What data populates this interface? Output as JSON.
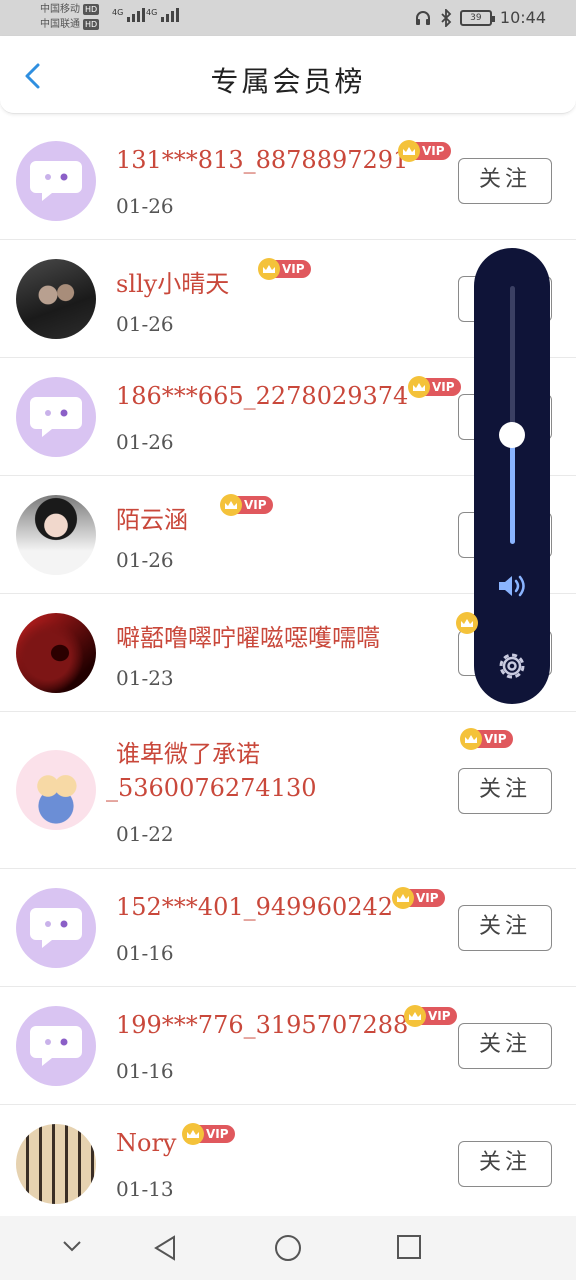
{
  "status_bar": {
    "carrier1": "中国移动",
    "carrier2": "中国联通",
    "hd": "HD",
    "net": "4G",
    "time": "10:44",
    "battery": "39"
  },
  "header": {
    "title": "专属会员榜"
  },
  "follow_label": "关注",
  "vip_label": "VIP",
  "members": [
    {
      "name": "131***813_8878897291",
      "date": "01-26"
    },
    {
      "name": "slly小晴天",
      "date": "01-26"
    },
    {
      "name": "186***665_2278029374",
      "date": "01-26"
    },
    {
      "name": "陌云涵",
      "date": "01-26"
    },
    {
      "name": "噼嚭噜噿咛曜嗞噁嚄嚅嚆",
      "date": "01-23"
    },
    {
      "name_line1": "谁卑微了承诺",
      "name_line2": "_5360076274130",
      "date": "01-22"
    },
    {
      "name": "152***401_949960242",
      "date": "01-16"
    },
    {
      "name": "199***776_3195707288",
      "date": "01-16"
    },
    {
      "name": "Nory",
      "date": "01-13"
    }
  ],
  "colors": {
    "accent": "#2f8fe0",
    "name": "#c9483b",
    "vip": "#e0585d",
    "crown": "#f4c23a",
    "default_avatar": "#d9c4f2",
    "volume_panel": "#0f1438"
  },
  "volume_level": 0.43
}
